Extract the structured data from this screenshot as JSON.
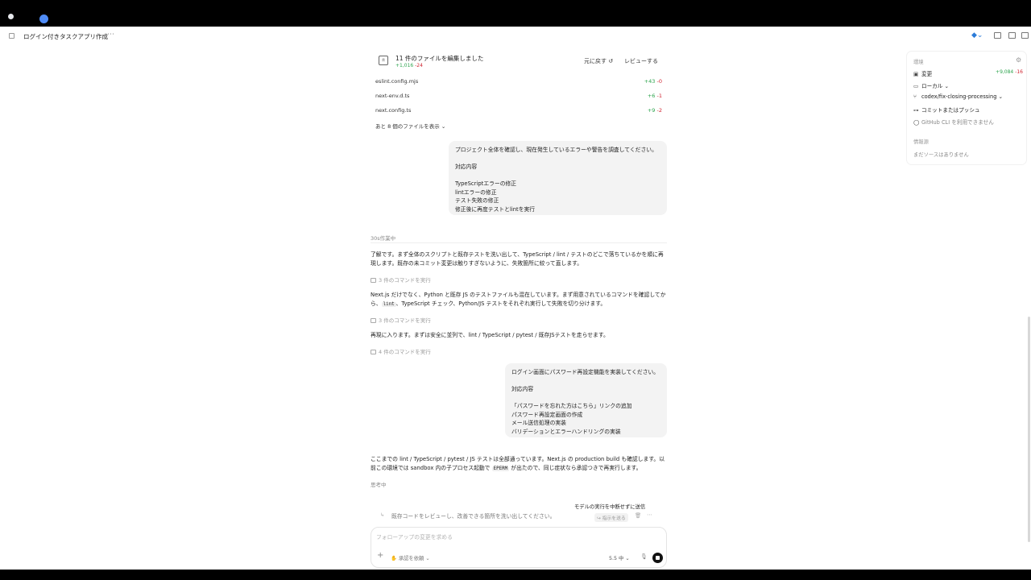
{
  "window": {
    "title": "ログイン付きタスクアプリ作成"
  },
  "files_card": {
    "title": "11 件のファイルを編集しました",
    "stat_plus": "+1,016",
    "stat_minus": "-24",
    "revert_label": "元に戻す ↺",
    "review_label": "レビューする",
    "files": [
      {
        "name": "eslint.config.mjs",
        "plus": "+43",
        "minus": "-0"
      },
      {
        "name": "next-env.d.ts",
        "plus": "+6",
        "minus": "-1"
      },
      {
        "name": "next.config.ts",
        "plus": "+9",
        "minus": "-2"
      }
    ],
    "show_more_label": "あと 8 個のファイルを表示 ⌄"
  },
  "user_message_1": {
    "lines": [
      "プロジェクト全体を確認し、現在発生しているエラーや警告を調査してください。",
      "",
      "対応内容",
      "",
      "TypeScriptエラーの修正",
      "lintエラーの修正",
      "テスト失敗の修正",
      "修正後に再度テストとlintを実行"
    ]
  },
  "working_label": "30s作業中",
  "assistant": {
    "p1": "了解です。まず全体のスクリプトと既存テストを洗い出して、TypeScript / lint / テストのどこで落ちているかを順に再現します。既存の未コミット変更は触りすぎないように、失敗箇所に絞って直します。",
    "cmd1": "3 件のコマンドを実行",
    "p2_a": "Next.js だけでなく、Python と既存 JS のテストファイルも混在しています。まず用意されているコマンドを確認してから、",
    "p2_code": "lint",
    "p2_b": "、TypeScript チェック、Python/JS テストをそれぞれ実行して失敗を切り分けます。",
    "cmd2": "3 件のコマンドを実行",
    "p3": "再現に入ります。まずは安全に並列で、lint / TypeScript / pytest / 既存JSテストを走らせます。",
    "cmd3": "4 件のコマンドを実行",
    "p4_a": "ここまでの lint / TypeScript / pytest / JS テストは全部通っています。Next.js の production build も確認します。以前この環境では sandbox 内の子プロセス起動で",
    "p4_code": "EPERM",
    "p4_b": "が出たので、同じ症状なら承認つきで再実行します。",
    "thinking": "思考中"
  },
  "user_message_2": {
    "lines": [
      "ログイン画面にパスワード再設定機能を実装してください。",
      "",
      "対応内容",
      "",
      "「パスワードを忘れた方はこちら」リンクの追加",
      "パスワード再設定画面の作成",
      "メール送信処理の実装",
      "バリデーションとエラーハンドリングの実装"
    ]
  },
  "queued": {
    "tooltip": "モデルの実行を中断せずに送信",
    "icon": "↳",
    "text": "既存コードをレビューし、改善できる箇所を洗い出してください。",
    "steer_label": "↪ 指示を送る",
    "trash_icon": "🗑",
    "more": "⋯"
  },
  "composer": {
    "placeholder": "フォローアップの変更を求める",
    "value": "",
    "plus": "+",
    "approval_label": "✋ 承認を依頼 ⌄",
    "model_label": "5.5 中 ⌄",
    "mic": "🎙"
  },
  "side_panel": {
    "env_heading": "環境",
    "changes_label": "変更",
    "changes_plus": "+9,084",
    "changes_minus": "-16",
    "local_label": "ローカル ⌄",
    "branch_label": "codex/fix-closing-processing ⌄",
    "commit_label": "コミットまたはプッシュ",
    "github_label": "GitHub CLI を利用できません",
    "sources_heading": "情報源",
    "sources_empty": "まだソースはありません"
  },
  "colors": {
    "added": "#2da44e",
    "removed": "#cf222e",
    "bubble_bg": "#f3f3f3"
  }
}
